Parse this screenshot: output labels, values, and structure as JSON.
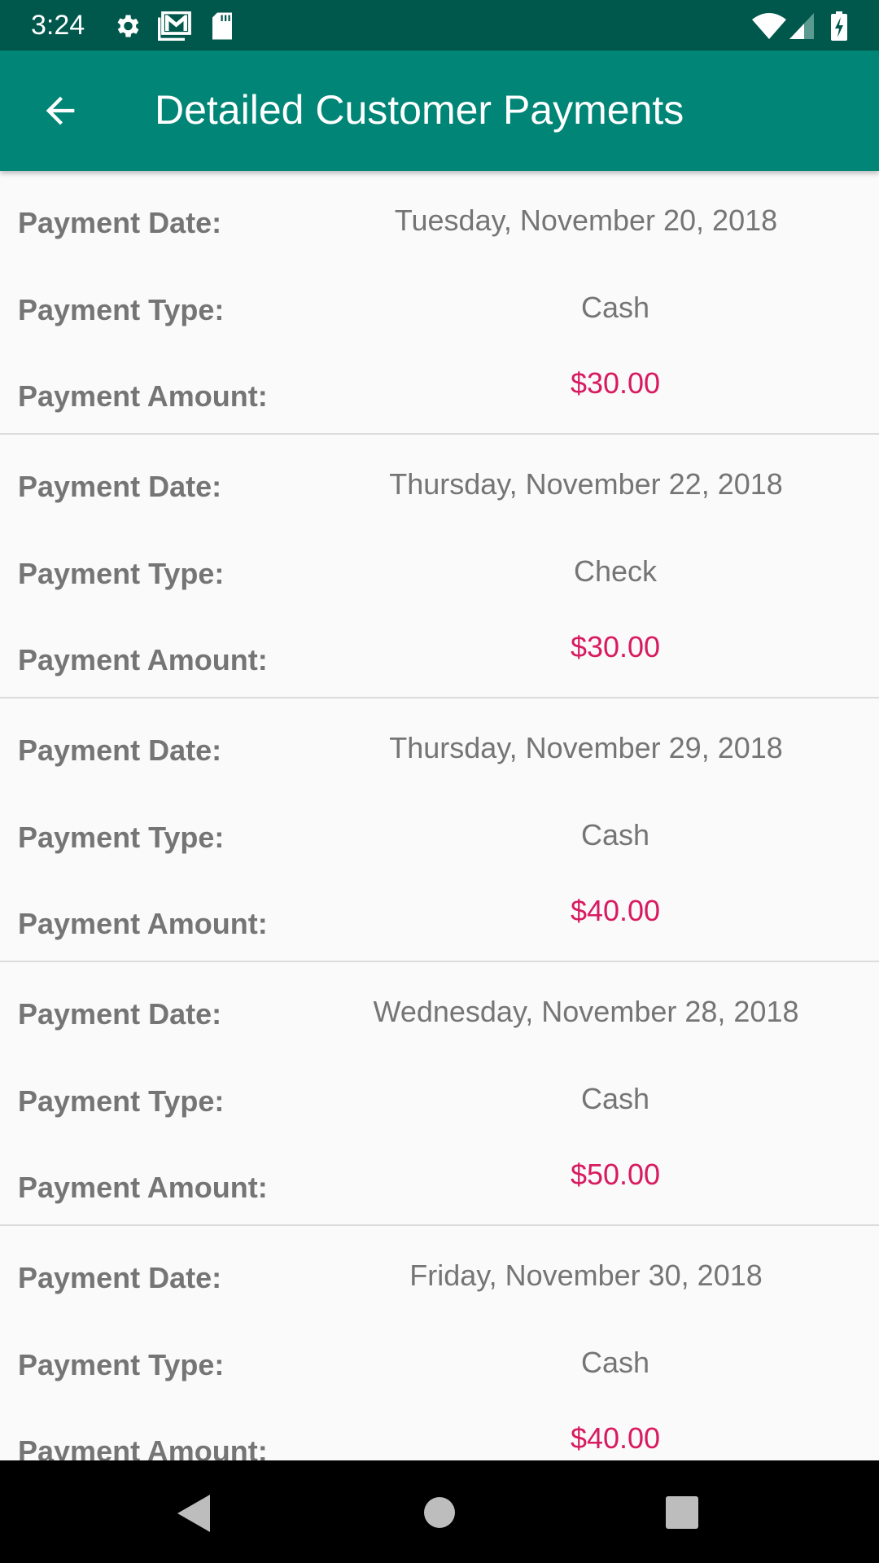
{
  "status_bar": {
    "time": "3:24",
    "icons": [
      "gear-icon",
      "gmail-icon",
      "sd-card-icon",
      "wifi-icon",
      "signal-icon",
      "battery-charging-icon"
    ]
  },
  "app_bar": {
    "title": "Detailed Customer Payments",
    "back_icon": "arrow-back-icon"
  },
  "labels": {
    "date": "Payment Date:",
    "type": "Payment Type:",
    "amount": "Payment Amount:"
  },
  "payments": [
    {
      "date": "Tuesday, November 20, 2018",
      "type": "Cash",
      "amount": "$30.00"
    },
    {
      "date": "Thursday, November 22, 2018",
      "type": "Check",
      "amount": "$30.00"
    },
    {
      "date": "Thursday, November 29, 2018",
      "type": "Cash",
      "amount": "$40.00"
    },
    {
      "date": "Wednesday, November 28, 2018",
      "type": "Cash",
      "amount": "$50.00"
    },
    {
      "date": "Friday, November 30, 2018",
      "type": "Cash",
      "amount": "$40.00"
    }
  ],
  "colors": {
    "primary": "#008577",
    "primary_dark": "#00574b",
    "accent": "#d81b60"
  }
}
